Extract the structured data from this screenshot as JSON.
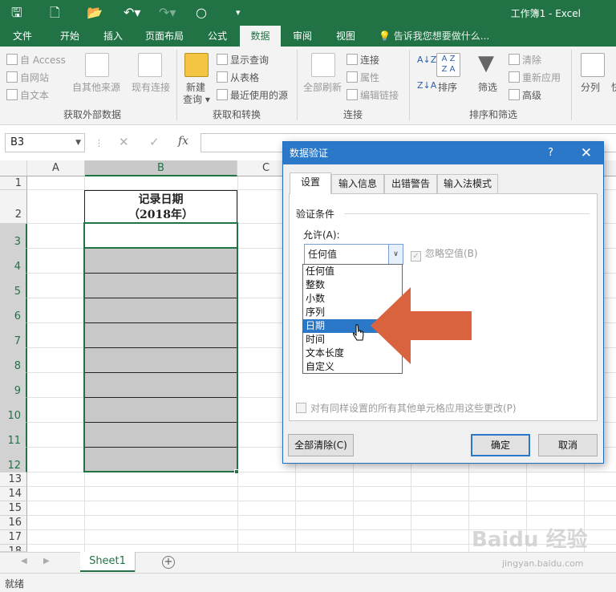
{
  "window": {
    "title": "工作簿1  -  Excel"
  },
  "tabs": [
    {
      "label": "文件"
    },
    {
      "label": "开始"
    },
    {
      "label": "插入"
    },
    {
      "label": "页面布局"
    },
    {
      "label": "公式"
    },
    {
      "label": "数据"
    },
    {
      "label": "审阅"
    },
    {
      "label": "视图"
    }
  ],
  "tell_me": "告诉我您想要做什么...",
  "ribbon": {
    "external": {
      "access": "自 Access",
      "web": "自网站",
      "text": "自文本",
      "other": "自其他来源",
      "existing": "现有连接",
      "group": "获取外部数据"
    },
    "transform": {
      "new_query": "新建",
      "new_query2": "查询",
      "show_queries": "显示查询",
      "from_table": "从表格",
      "recent": "最近使用的源",
      "group": "获取和转换"
    },
    "connections": {
      "refresh_all": "全部刷新",
      "connections": "连接",
      "properties": "属性",
      "edit_links": "编辑链接",
      "group": "连接"
    },
    "sort_filter": {
      "sort": "排序",
      "filter": "筛选",
      "clear": "清除",
      "reapply": "重新应用",
      "advanced": "高级",
      "group": "排序和筛选"
    },
    "tools": {
      "split": "分列",
      "quick": "快"
    }
  },
  "namebox": "B3",
  "columns": [
    "A",
    "B",
    "C"
  ],
  "rows": [
    "1",
    "2",
    "3",
    "4",
    "5",
    "6",
    "7",
    "8",
    "9",
    "10",
    "11",
    "12",
    "13",
    "14",
    "15",
    "16",
    "17",
    "18"
  ],
  "header_cell": {
    "line1": "记录日期",
    "line2": "（2018年）"
  },
  "sheet_tab": "Sheet1",
  "status": "就绪",
  "dialog": {
    "title": "数据验证",
    "help": "?",
    "tabs": [
      "设置",
      "输入信息",
      "出错警告",
      "输入法模式"
    ],
    "criteria_label": "验证条件",
    "allow_label": "允许(A):",
    "allow_value": "任何值",
    "ignore_blank": "忽略空值(B)",
    "options": [
      "任何值",
      "整数",
      "小数",
      "序列",
      "日期",
      "时间",
      "文本长度",
      "自定义"
    ],
    "highlighted_option": "日期",
    "apply_all": "对有同样设置的所有其他单元格应用这些更改(P)",
    "clear_all": "全部清除(C)",
    "ok": "确定",
    "cancel": "取消"
  },
  "colors": {
    "excel_green": "#217346",
    "dialog_blue": "#2b78c8",
    "arrow": "#d9633f",
    "cell_gray": "#c8c8c8"
  },
  "watermark": {
    "brand": "Baidu 经验",
    "url": "jingyan.baidu.com"
  }
}
